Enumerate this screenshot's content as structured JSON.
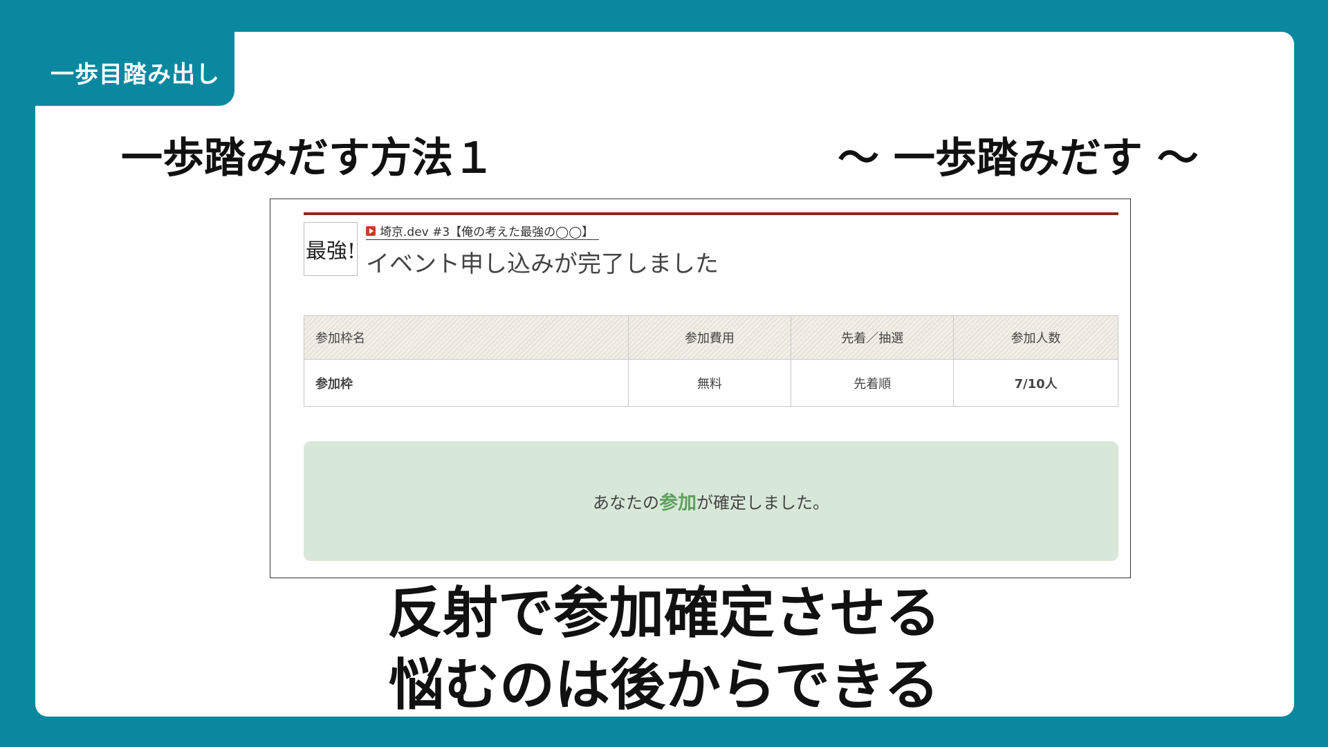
{
  "section_tag": "一歩目踏み出し",
  "title": "一歩踏みだす方法１",
  "subtitle": "〜 一歩踏みだす 〜",
  "screenshot": {
    "thumbnail_text": "最強!",
    "event_link": "埼京.dev #3【俺の考えた最強の◯◯】",
    "complete_title": "イベント申し込みが完了しました",
    "table": {
      "headers": [
        "参加枠名",
        "参加費用",
        "先着／抽選",
        "参加人数"
      ],
      "row": [
        "参加枠",
        "無料",
        "先着順",
        "7/10人"
      ]
    },
    "confirm": {
      "before": "あなたの",
      "accent": "参加",
      "after": "が確定しました。"
    },
    "colors": {
      "top_bar": "#8b2a1a",
      "confirm_bg": "#d8e8d8",
      "accent": "#5f9f5f"
    }
  },
  "message": {
    "line1": "反射で参加確定させる",
    "line2": "悩むのは後からできる"
  },
  "colors": {
    "background": "#0a88a0",
    "card": "#ffffff"
  }
}
